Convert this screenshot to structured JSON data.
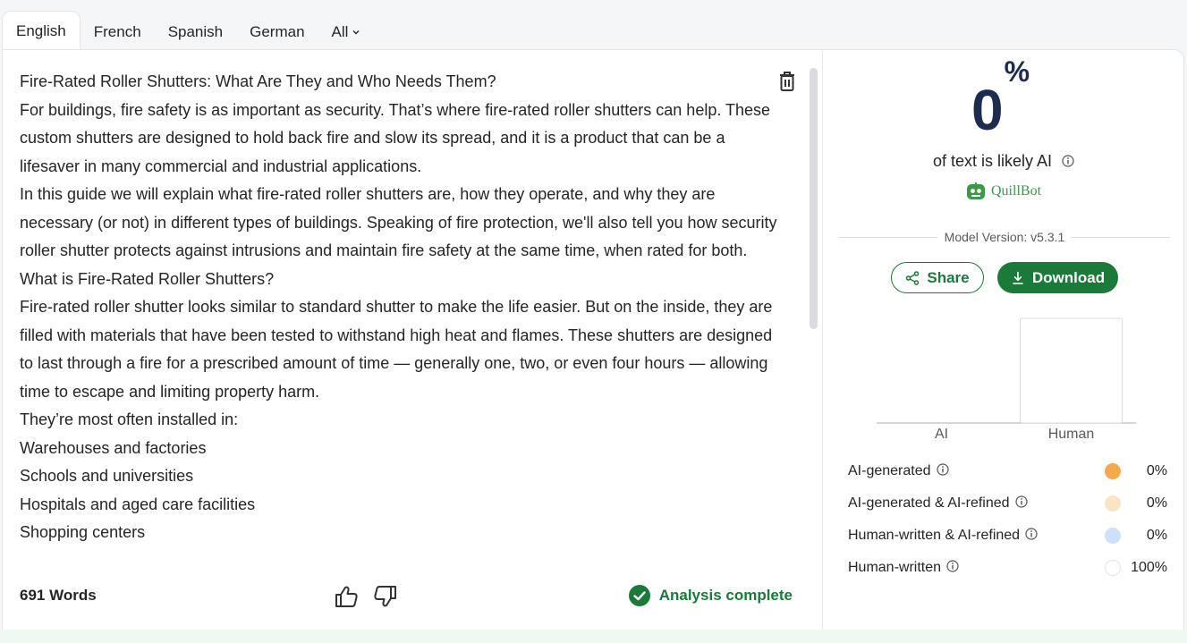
{
  "tabs": [
    "English",
    "French",
    "Spanish",
    "German",
    "All"
  ],
  "active_tab": "English",
  "document": {
    "paragraphs": [
      "Fire-Rated Roller Shutters: What Are They and Who Needs Them?",
      "For buildings, fire safety is as important as security. That’s where fire-rated roller shutters can help. These custom shutters are designed to hold back fire and slow its spread, and it is a product that can be a lifesaver in many commercial and industrial applications.",
      "In this guide we will explain what fire-rated roller shutters are, how they operate, and why they are necessary (or not) in different types of buildings. Speaking of fire protection, we'll also tell you how security roller shutter protects against intrusions and maintain fire safety at the same time, when rated for both.",
      "What is Fire-Rated Roller Shutters?",
      "Fire-rated roller shutter looks similar to standard shutter to make the life easier. But on the inside, they are filled with materials that have been tested to withstand high heat and flames. These shutters are designed to last through a fire for a prescribed amount of time — generally one, two, or even four hours — allowing time to escape and limiting property harm.",
      "They’re most often installed in:",
      "Warehouses and factories",
      "Schools and universities",
      "Hospitals and aged care facilities",
      "Shopping centers"
    ]
  },
  "footer": {
    "word_count": "691 Words",
    "status": "Analysis complete"
  },
  "result": {
    "percent": "0",
    "percent_sign": "%",
    "caption": "of text is likely AI",
    "brand": "QuillBot",
    "model_version": "Model Version: v5.3.1",
    "share_label": "Share",
    "download_label": "Download"
  },
  "chart_data": {
    "type": "bar",
    "categories": [
      "AI",
      "Human"
    ],
    "values": [
      0,
      100
    ],
    "ylim": [
      0,
      100
    ],
    "grid": false
  },
  "legend": [
    {
      "label": "AI-generated",
      "value": "0%",
      "color": "#f6a94a"
    },
    {
      "label": "AI-generated & AI-refined",
      "value": "0%",
      "color": "#fbe3c6"
    },
    {
      "label": "Human-written & AI-refined",
      "value": "0%",
      "color": "#cfe0fb"
    },
    {
      "label": "Human-written",
      "value": "100%",
      "color": "#ffffff"
    }
  ],
  "colors": {
    "brand_green": "#1b7a3a",
    "percent_navy": "#1d2b4f"
  }
}
